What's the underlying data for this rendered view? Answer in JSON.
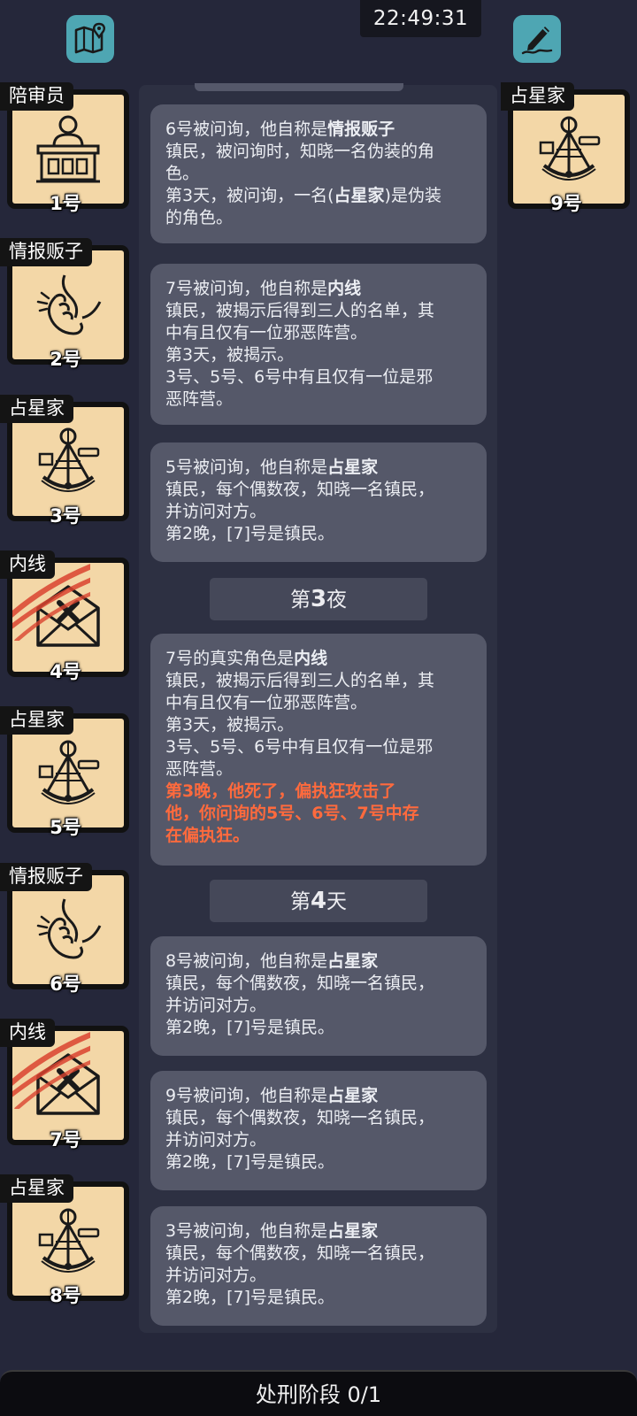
{
  "clock": "22:49:31",
  "top_icons": {
    "left": "map-icon",
    "right": "notes-pen-icon"
  },
  "players_left": [
    {
      "role": "陪审员",
      "number": "1号",
      "icon": "juror-podium-icon",
      "slashed": false
    },
    {
      "role": "情报贩子",
      "number": "2号",
      "icon": "whisper-icon",
      "slashed": false
    },
    {
      "role": "占星家",
      "number": "3号",
      "icon": "sextant-icon",
      "slashed": false
    },
    {
      "role": "内线",
      "number": "4号",
      "icon": "envelope-icon",
      "slashed": true
    },
    {
      "role": "占星家",
      "number": "5号",
      "icon": "sextant-icon",
      "slashed": false
    },
    {
      "role": "情报贩子",
      "number": "6号",
      "icon": "whisper-icon",
      "slashed": false
    },
    {
      "role": "内线",
      "number": "7号",
      "icon": "envelope-icon",
      "slashed": true
    },
    {
      "role": "占星家",
      "number": "8号",
      "icon": "sextant-icon",
      "slashed": false
    }
  ],
  "player_right": {
    "role": "占星家",
    "number": "9号",
    "icon": "sextant-icon",
    "slashed": false
  },
  "log": {
    "m1": {
      "a": "6号被问询，他自称是",
      "b": "情报贩子",
      "l2": "镇民，被问询时，知晓一名伪装的角",
      "l3": "色。",
      "l4a": "第3天，被问询，一名(",
      "l4b": "占星家",
      "l4c": ")是伪装",
      "l5": "的角色。"
    },
    "m2": {
      "a": "7号被问询，他自称是",
      "b": "内线",
      "l2": "镇民，被揭示后得到三人的名单，其",
      "l3": "中有且仅有一位邪恶阵营。",
      "l4": "第3天，被揭示。",
      "l5": "3号、5号、6号中有且仅有一位是邪",
      "l6": "恶阵营。"
    },
    "m3": {
      "a": "5号被问询，他自称是",
      "b": "占星家",
      "l2": "镇民，每个偶数夜，知晓一名镇民，",
      "l3": "并访问对方。",
      "l4": "第2晚，[7]号是镇民。"
    },
    "d1": {
      "a": "第",
      "b": "3",
      "c": "夜"
    },
    "m4": {
      "a": "7号的真实角色是",
      "b": "内线",
      "l2": "镇民，被揭示后得到三人的名单，其",
      "l3": "中有且仅有一位邪恶阵营。",
      "l4": "第3天，被揭示。",
      "l5": "3号、5号、6号中有且仅有一位是邪",
      "l6": "恶阵营。",
      "r1": "第3晚，他死了，偏执狂攻击了",
      "r2": "他，你问询的5号、6号、7号中存",
      "r3": "在偏执狂。"
    },
    "d2": {
      "a": "第",
      "b": "4",
      "c": "天"
    },
    "m5": {
      "a": "8号被问询，他自称是",
      "b": "占星家",
      "l2": "镇民，每个偶数夜，知晓一名镇民，",
      "l3": "并访问对方。",
      "l4": "第2晚，[7]号是镇民。"
    },
    "m6": {
      "a": "9号被问询，他自称是",
      "b": "占星家",
      "l2": "镇民，每个偶数夜，知晓一名镇民，",
      "l3": "并访问对方。",
      "l4": "第2晚，[7]号是镇民。"
    },
    "m7": {
      "a": "3号被问询，他自称是",
      "b": "占星家",
      "l2": "镇民，每个偶数夜，知晓一名镇民，",
      "l3": "并访问对方。",
      "l4": "第2晚，[7]号是镇民。"
    }
  },
  "bottom_bar": "处刑阶段 0/1",
  "colors": {
    "background": "#25273a",
    "message_bg": "#555869",
    "card_bg": "#f3d7a7",
    "highlight_red": "#ff6a3d",
    "top_icon_bg": "#4ea6b3"
  }
}
